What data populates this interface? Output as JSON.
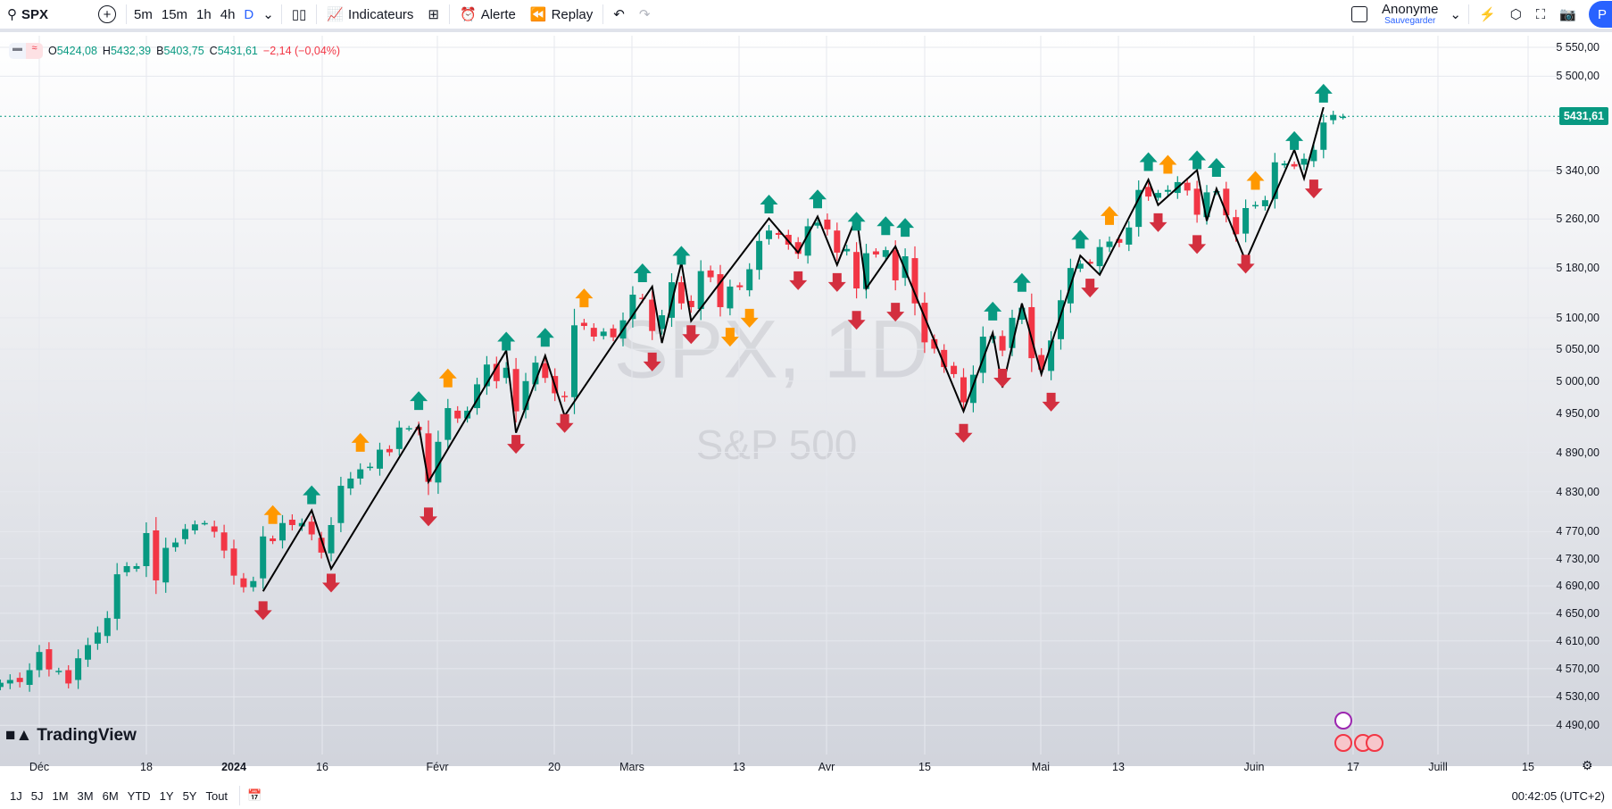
{
  "toolbar": {
    "symbol": "SPX",
    "timeframes": [
      "5m",
      "15m",
      "1h",
      "4h",
      "D"
    ],
    "active_timeframe": "D",
    "indicators": "Indicateurs",
    "alert": "Alerte",
    "replay": "Replay",
    "user": "Anonyme",
    "save": "Sauvegarder",
    "avatar": "P"
  },
  "legend": {
    "o_label": "O",
    "o": "5424,08",
    "h_label": "H",
    "h": "5432,39",
    "b_label": "B",
    "b": "5403,75",
    "c_label": "C",
    "c": "5431,61",
    "change": "−2,14 (−0,04%)"
  },
  "watermark": {
    "symbol": "SPX, 1D",
    "name": "S&P 500"
  },
  "logo": "TradingView",
  "last_price": "5431,61",
  "colors": {
    "up": "#089981",
    "down": "#f23645",
    "signal_up": "#089981",
    "signal_down": "#d32f3f",
    "signal_orange": "#ff9800",
    "zigzag": "#000000",
    "accent": "#2962ff"
  },
  "chart_data": {
    "type": "candlestick",
    "y_scale": "log",
    "ylim": [
      4470,
      5580
    ],
    "price_ticks": [
      "5 550,00",
      "5 500,00",
      "5 340,00",
      "5 260,00",
      "5 180,00",
      "5 100,00",
      "5 050,00",
      "5 000,00",
      "4 950,00",
      "4 890,00",
      "4 830,00",
      "4 770,00",
      "4 730,00",
      "4 690,00",
      "4 650,00",
      "4 610,00",
      "4 570,00",
      "4 530,00",
      "4 490,00"
    ],
    "time_ticks": [
      "Déc",
      "18",
      "2024",
      "16",
      "Févr",
      "20",
      "Mars",
      "13",
      "Avr",
      "15",
      "Mai",
      "13",
      "Juin",
      "17",
      "Juill",
      "15"
    ],
    "closes": [
      4550,
      4554,
      4551,
      4568,
      4594,
      4569,
      4567,
      4549,
      4585,
      4604,
      4622,
      4643,
      4707,
      4719,
      4719,
      4768,
      4698,
      4746,
      4754,
      4774,
      4781,
      4783,
      4770,
      4742,
      4705,
      4688,
      4697,
      4763,
      4756,
      4783,
      4780,
      4783,
      4766,
      4739,
      4780,
      4839,
      4850,
      4864,
      4868,
      4894,
      4890,
      4928,
      4927,
      4924,
      4845,
      4906,
      4958,
      4942,
      4954,
      4995,
      5026,
      5000,
      5021,
      4953,
      5000,
      5029,
      5005,
      4981,
      4975,
      5088,
      5087,
      5070,
      5078,
      5069,
      5096,
      5137,
      5130,
      5079,
      5104,
      5157,
      5123,
      5117,
      5175,
      5165,
      5117,
      5150,
      5149,
      5178,
      5224,
      5241,
      5234,
      5218,
      5203,
      5248,
      5254,
      5243,
      5205,
      5211,
      5147,
      5204,
      5202,
      5209,
      5160,
      5199,
      5123,
      5061,
      5051,
      5022,
      5011,
      4967,
      5010,
      5070,
      5071,
      5048,
      5100,
      5116,
      5036,
      5018,
      5064,
      5128,
      5180,
      5187,
      5187,
      5214,
      5223,
      5221,
      5246,
      5308,
      5297,
      5303,
      5308,
      5321,
      5307,
      5267,
      5304,
      5306,
      5266,
      5235,
      5278,
      5283,
      5291,
      5354,
      5352,
      5347,
      5360,
      5375,
      5421,
      5434,
      5431
    ],
    "zigzag": [
      [
        27,
        4682
      ],
      [
        32,
        4802
      ],
      [
        34,
        4715
      ],
      [
        43,
        4931
      ],
      [
        44,
        4845
      ],
      [
        52,
        5048
      ],
      [
        53,
        4920
      ],
      [
        56,
        5040
      ],
      [
        58,
        4946
      ],
      [
        67,
        5150
      ],
      [
        68,
        5060
      ],
      [
        70,
        5189
      ],
      [
        71,
        5095
      ],
      [
        79,
        5261
      ],
      [
        82,
        5205
      ],
      [
        84,
        5264
      ],
      [
        86,
        5185
      ],
      [
        88,
        5264
      ],
      [
        89,
        5147
      ],
      [
        92,
        5215
      ],
      [
        99,
        4953
      ],
      [
        102,
        5076
      ],
      [
        103,
        4990
      ],
      [
        105,
        5123
      ],
      [
        107,
        5011
      ],
      [
        111,
        5200
      ],
      [
        113,
        5169
      ],
      [
        118,
        5325
      ],
      [
        119,
        5283
      ],
      [
        123,
        5341
      ],
      [
        124,
        5257
      ],
      [
        125,
        5310
      ],
      [
        128,
        5191
      ],
      [
        133,
        5375
      ],
      [
        134,
        5327
      ],
      [
        136,
        5447
      ]
    ],
    "signals": {
      "down_red": [
        27,
        34,
        44,
        53,
        58,
        67,
        71,
        82,
        86,
        88,
        92,
        99,
        103,
        108,
        112,
        119,
        123,
        128,
        135
      ],
      "up_green": [
        32,
        43,
        52,
        56,
        66,
        70,
        79,
        84,
        88,
        91,
        93,
        102,
        105,
        111,
        118,
        123,
        125,
        133,
        136
      ],
      "up_orange": [
        28,
        37,
        46,
        60,
        114,
        120,
        129
      ],
      "down_orange": [
        75,
        77
      ]
    }
  },
  "bottom": {
    "ranges": [
      "1J",
      "5J",
      "1M",
      "3M",
      "6M",
      "YTD",
      "1Y",
      "5Y",
      "Tout"
    ],
    "time": "00:42:05 (UTC+2)"
  }
}
